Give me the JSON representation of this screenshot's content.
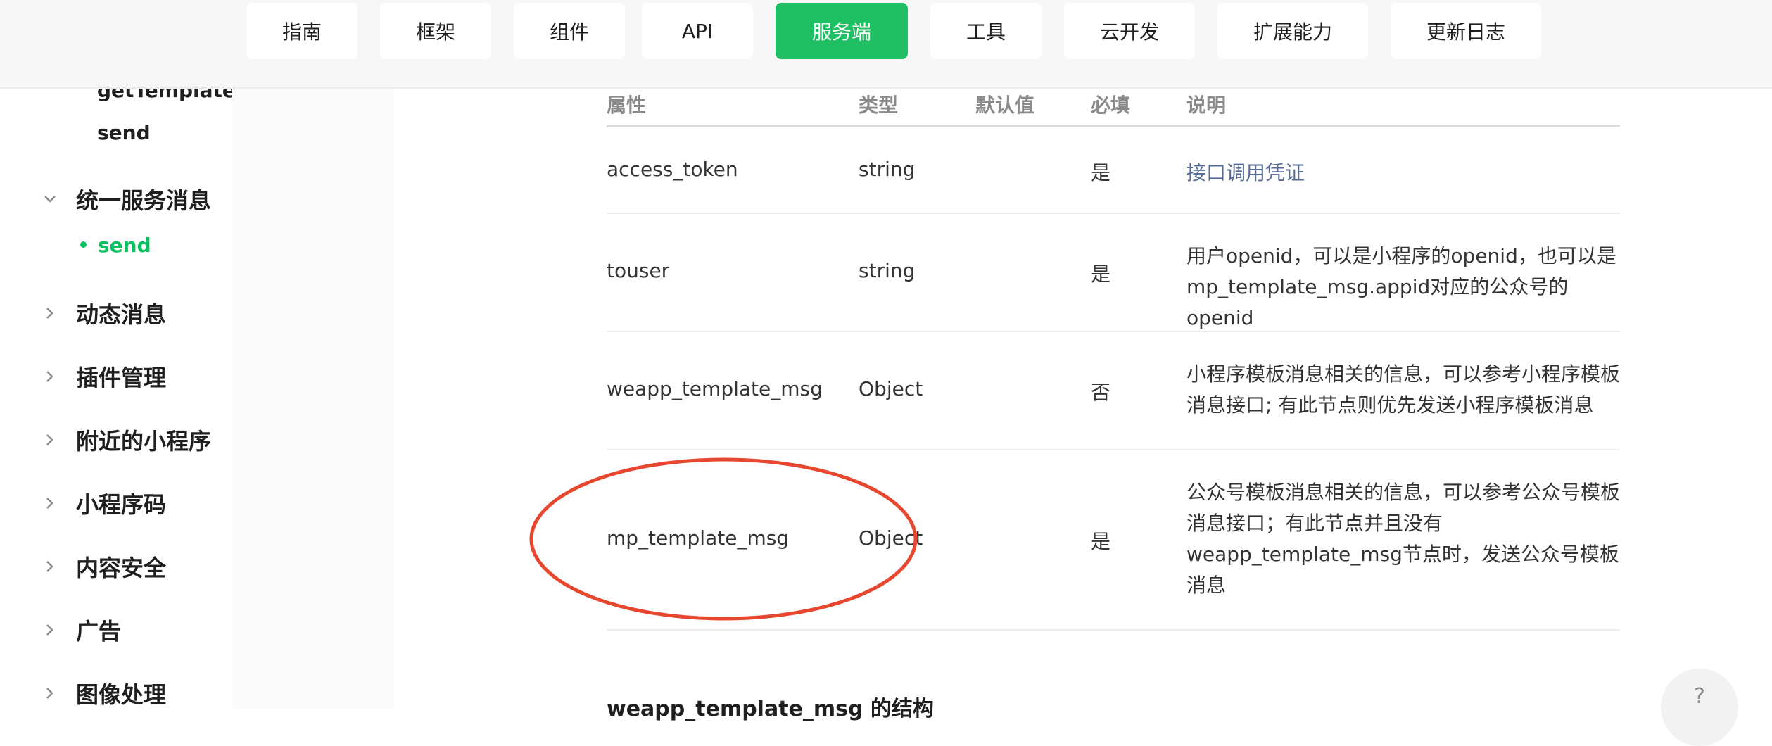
{
  "nav": {
    "items": [
      "指南",
      "框架",
      "组件",
      "API",
      "服务端",
      "工具",
      "云开发",
      "扩展能力",
      "更新日志"
    ],
    "active_index": 4
  },
  "sidebar": {
    "partial_item": "getTemplateList",
    "sub_send": "send",
    "group_open": "统一服务消息",
    "active_item": "send",
    "groups": [
      "动态消息",
      "插件管理",
      "附近的小程序",
      "小程序码",
      "内容安全",
      "广告",
      "图像处理"
    ]
  },
  "table": {
    "headers": [
      "属性",
      "类型",
      "默认值",
      "必填",
      "说明"
    ],
    "rows": [
      {
        "name": "access_token",
        "type": "string",
        "default": "",
        "required": "是",
        "desc": "接口调用凭证"
      },
      {
        "name": "touser",
        "type": "string",
        "default": "",
        "required": "是",
        "desc": "用户openid，可以是小程序的openid，也可以是mp_template_msg.appid对应的公众号的openid"
      },
      {
        "name": "weapp_template_msg",
        "type": "Object",
        "default": "",
        "required": "否",
        "desc": "小程序模板消息相关的信息，可以参考小程序模板消息接口; 有此节点则优先发送小程序模板消息"
      },
      {
        "name": "mp_template_msg",
        "type": "Object",
        "default": "",
        "required": "是",
        "desc": "公众号模板消息相关的信息，可以参考公众号模板消息接口；有此节点并且没有weapp_template_msg节点时，发送公众号模板消息"
      }
    ]
  },
  "section_title": "weapp_template_msg 的结构",
  "help": "?",
  "colors": {
    "accent": "#07c160",
    "nav_active": "#1fbf63",
    "link": "#576b95",
    "annotation": "#e8472f"
  }
}
